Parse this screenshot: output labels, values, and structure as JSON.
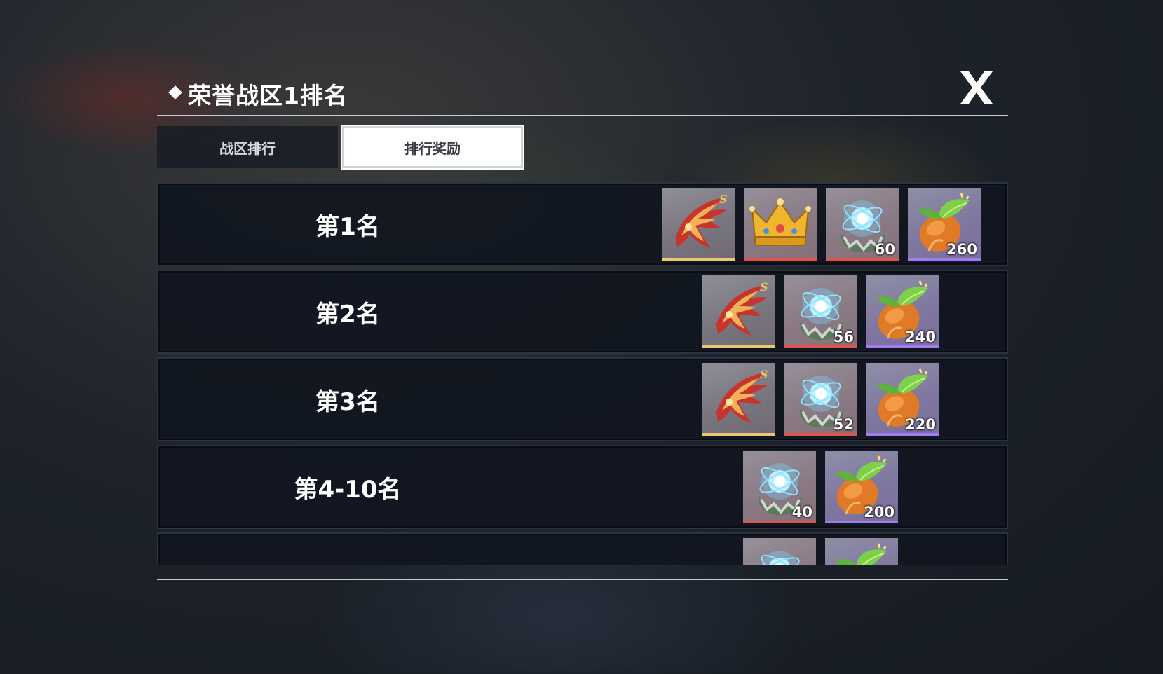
{
  "title": "荣誉战区1排名",
  "tabs": [
    {
      "label": "战区排行",
      "active": false
    },
    {
      "label": "排行奖励",
      "active": true
    }
  ],
  "rows": [
    {
      "rank": "第1名",
      "rewards": [
        {
          "icon": "phoenix-wing-icon",
          "rarity": "gold",
          "count": ""
        },
        {
          "icon": "crown-icon",
          "rarity": "red",
          "count": ""
        },
        {
          "icon": "energy-orb-icon",
          "rarity": "red",
          "count": "60"
        },
        {
          "icon": "sprout-seed-icon",
          "rarity": "purple",
          "count": "260"
        }
      ]
    },
    {
      "rank": "第2名",
      "rewards": [
        {
          "icon": "phoenix-wing-icon",
          "rarity": "gold",
          "count": ""
        },
        {
          "icon": "energy-orb-icon",
          "rarity": "red",
          "count": "56"
        },
        {
          "icon": "sprout-seed-icon",
          "rarity": "purple",
          "count": "240"
        }
      ]
    },
    {
      "rank": "第3名",
      "rewards": [
        {
          "icon": "phoenix-wing-icon",
          "rarity": "gold",
          "count": ""
        },
        {
          "icon": "energy-orb-icon",
          "rarity": "red",
          "count": "52"
        },
        {
          "icon": "sprout-seed-icon",
          "rarity": "purple",
          "count": "220"
        }
      ]
    },
    {
      "rank": "第4-10名",
      "rewards": [
        {
          "icon": "energy-orb-icon",
          "rarity": "red",
          "count": "40"
        },
        {
          "icon": "sprout-seed-icon",
          "rarity": "purple",
          "count": "200"
        }
      ]
    },
    {
      "rank": "",
      "rewards": [
        {
          "icon": "energy-orb-icon",
          "rarity": "red",
          "count": ""
        },
        {
          "icon": "sprout-seed-icon",
          "rarity": "purple",
          "count": ""
        }
      ]
    }
  ],
  "colors": {
    "rarity_gold": "#e9c774",
    "rarity_red": "#e0524a",
    "rarity_purple": "#a07cf0"
  }
}
